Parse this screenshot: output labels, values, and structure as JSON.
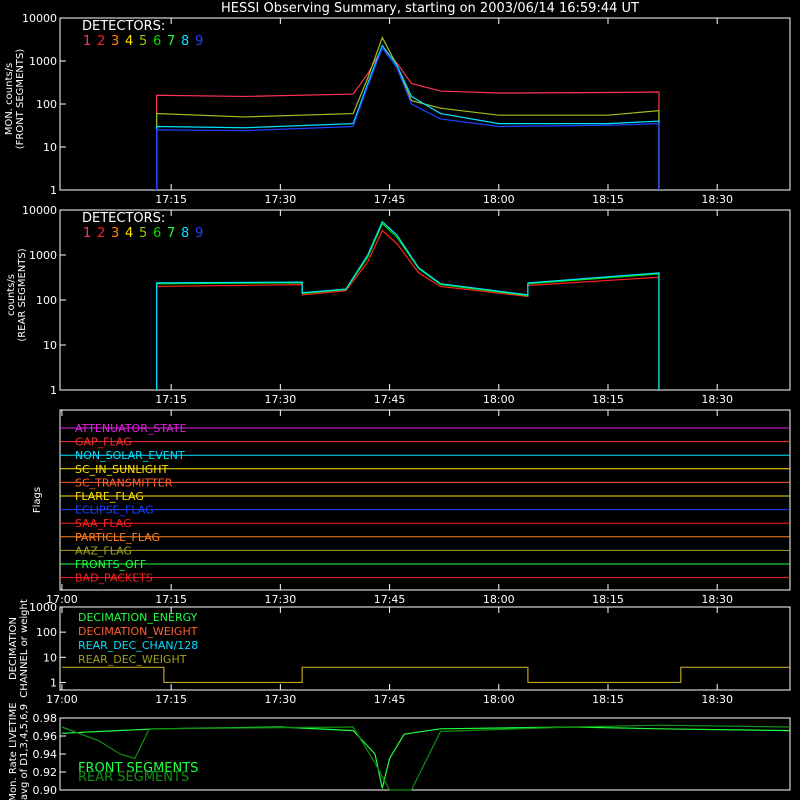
{
  "title": "HESSI Observing Summary, starting on 2003/06/14 16:59:44 UT",
  "time_ticks": [
    "17:15",
    "17:30",
    "17:45",
    "18:00",
    "18:15",
    "18:30"
  ],
  "time_ticks_full": [
    "17:00",
    "17:15",
    "17:30",
    "17:45",
    "18:00",
    "18:15",
    "18:30"
  ],
  "detectors_label": "DETECTORS:",
  "detectors": [
    {
      "n": "1",
      "color": "#ff3355"
    },
    {
      "n": "2",
      "color": "#ff2020"
    },
    {
      "n": "3",
      "color": "#ff8800"
    },
    {
      "n": "4",
      "color": "#ffe000"
    },
    {
      "n": "5",
      "color": "#a0c020"
    },
    {
      "n": "6",
      "color": "#00e000"
    },
    {
      "n": "7",
      "color": "#20ff40"
    },
    {
      "n": "8",
      "color": "#00e0ff"
    },
    {
      "n": "9",
      "color": "#2040ff"
    }
  ],
  "chart_data": [
    {
      "type": "line",
      "ylabel": "MON. counts/s\n(FRONT SEGMENTS)",
      "yscale": "log",
      "ylim": [
        1,
        10000
      ],
      "yticks": [
        "1",
        "10",
        "100",
        "1000",
        "10000"
      ],
      "xlim": [
        "16:59:44",
        "18:40"
      ],
      "series": [
        {
          "name": "1",
          "color": "#ff3355",
          "x": [
            "17:13",
            "17:13",
            "17:25",
            "17:40",
            "17:42",
            "17:44",
            "17:46",
            "17:48",
            "17:52",
            "18:00",
            "18:15",
            "18:22",
            "18:22"
          ],
          "y": [
            1,
            160,
            150,
            170,
            500,
            2000,
            900,
            300,
            200,
            180,
            185,
            190,
            1
          ]
        },
        {
          "name": "5",
          "color": "#a0c020",
          "x": [
            "17:13",
            "17:13",
            "17:25",
            "17:40",
            "17:42",
            "17:44",
            "17:46",
            "17:48",
            "17:52",
            "18:00",
            "18:15",
            "18:22",
            "18:22"
          ],
          "y": [
            1,
            60,
            50,
            60,
            400,
            3500,
            800,
            120,
            80,
            55,
            55,
            70,
            1
          ]
        },
        {
          "name": "8",
          "color": "#00e0ff",
          "x": [
            "17:13",
            "17:13",
            "17:25",
            "17:40",
            "17:42",
            "17:44",
            "17:46",
            "17:48",
            "17:52",
            "18:00",
            "18:15",
            "18:22",
            "18:22"
          ],
          "y": [
            1,
            30,
            28,
            35,
            300,
            2300,
            800,
            150,
            60,
            35,
            35,
            40,
            1
          ]
        },
        {
          "name": "9",
          "color": "#2040ff",
          "x": [
            "17:13",
            "17:13",
            "17:25",
            "17:40",
            "17:42",
            "17:44",
            "17:46",
            "17:48",
            "17:52",
            "18:00",
            "18:15",
            "18:22",
            "18:22"
          ],
          "y": [
            1,
            25,
            24,
            30,
            260,
            2000,
            700,
            100,
            45,
            30,
            32,
            35,
            1
          ]
        }
      ]
    },
    {
      "type": "line",
      "ylabel": "counts/s\n(REAR SEGMENTS)",
      "yscale": "log",
      "ylim": [
        1,
        10000
      ],
      "yticks": [
        "1",
        "10",
        "100",
        "1000",
        "10000"
      ],
      "xlim": [
        "16:59:44",
        "18:40"
      ],
      "series": [
        {
          "name": "2",
          "color": "#ff2020",
          "x": [
            "17:13",
            "17:13",
            "17:33",
            "17:33",
            "17:39",
            "17:42",
            "17:44",
            "17:46",
            "17:49",
            "17:52",
            "18:04",
            "18:04",
            "18:22",
            "18:22"
          ],
          "y": [
            1,
            200,
            220,
            130,
            160,
            700,
            3500,
            1800,
            400,
            200,
            120,
            210,
            320,
            1
          ]
        },
        {
          "name": "6",
          "color": "#00e000",
          "x": [
            "17:13",
            "17:13",
            "17:33",
            "17:33",
            "17:39",
            "17:42",
            "17:44",
            "17:46",
            "17:49",
            "17:52",
            "18:04",
            "18:04",
            "18:22",
            "18:22"
          ],
          "y": [
            1,
            230,
            240,
            140,
            170,
            900,
            5000,
            2500,
            500,
            220,
            125,
            230,
            380,
            1
          ]
        },
        {
          "name": "8",
          "color": "#00e0ff",
          "x": [
            "17:13",
            "17:13",
            "17:33",
            "17:33",
            "17:39",
            "17:42",
            "17:44",
            "17:46",
            "17:49",
            "17:52",
            "18:04",
            "18:04",
            "18:22",
            "18:22"
          ],
          "y": [
            1,
            240,
            250,
            145,
            175,
            1000,
            5500,
            2800,
            520,
            230,
            130,
            240,
            400,
            1
          ]
        }
      ]
    },
    {
      "type": "line",
      "ylabel": "Flags",
      "flags": [
        {
          "name": "ATTENUATOR_STATE",
          "color": "#e020e0"
        },
        {
          "name": "GAP_FLAG",
          "color": "#ff3030"
        },
        {
          "name": "NON_SOLAR_EVENT",
          "color": "#00e0ff"
        },
        {
          "name": "SC_IN_SUNLIGHT",
          "color": "#ffe000"
        },
        {
          "name": "SC_TRANSMITTER",
          "color": "#ff6030"
        },
        {
          "name": "FLARE_FLAG",
          "color": "#ffe000"
        },
        {
          "name": "ECLIPSE_FLAG",
          "color": "#2040ff"
        },
        {
          "name": "SAA_FLAG",
          "color": "#ff2020"
        },
        {
          "name": "PARTICLE_FLAG",
          "color": "#ff8020"
        },
        {
          "name": "AAZ_FLAG",
          "color": "#a0a020"
        },
        {
          "name": "FRONTS_OFF",
          "color": "#20ff40"
        },
        {
          "name": "BAD_PACKETS",
          "color": "#ff2020"
        }
      ]
    },
    {
      "type": "line",
      "ylabel": "DECIMATION\nCHANNEL or weight",
      "yscale": "log",
      "ylim": [
        0.5,
        1000
      ],
      "yticks": [
        "1",
        "10",
        "100",
        "1000"
      ],
      "legend": [
        {
          "name": "DECIMATION_ENERGY",
          "color": "#20ff40"
        },
        {
          "name": "DECIMATION_WEIGHT",
          "color": "#ff6030"
        },
        {
          "name": "REAR_DEC_CHAN/128",
          "color": "#00e0ff"
        },
        {
          "name": "REAR_DEC_WEIGHT",
          "color": "#a0a020"
        }
      ],
      "series": [
        {
          "name": "REAR_DEC_WEIGHT",
          "color": "#c0a020",
          "x": [
            "17:00",
            "17:14",
            "17:14",
            "17:33",
            "17:33",
            "18:04",
            "18:04",
            "18:25",
            "18:25",
            "18:40"
          ],
          "y": [
            4,
            4,
            1,
            1,
            4,
            4,
            1,
            1,
            4,
            4
          ]
        }
      ]
    },
    {
      "type": "line",
      "ylabel": "Mon. Rate LIVETIME\navg of D1,3,4,5,6,9",
      "ylim": [
        0.9,
        0.98
      ],
      "yticks": [
        "0.90",
        "0.92",
        "0.94",
        "0.96",
        "0.98"
      ],
      "legend": [
        {
          "name": "FRONT SEGMENTS",
          "color": "#20ff40"
        },
        {
          "name": "REAR SEGMENTS",
          "color": "#109010"
        }
      ],
      "series": [
        {
          "name": "FRONT SEGMENTS",
          "color": "#20ff40",
          "x": [
            "17:00",
            "17:13",
            "17:30",
            "17:40",
            "17:43",
            "17:44",
            "17:45",
            "17:47",
            "17:52",
            "18:10",
            "18:22",
            "18:40"
          ],
          "y": [
            0.963,
            0.968,
            0.97,
            0.966,
            0.94,
            0.902,
            0.935,
            0.962,
            0.968,
            0.97,
            0.968,
            0.966
          ]
        },
        {
          "name": "REAR SEGMENTS",
          "color": "#109010",
          "x": [
            "17:00",
            "17:05",
            "17:08",
            "17:10",
            "17:12",
            "17:40",
            "17:43",
            "17:45",
            "17:48",
            "17:52",
            "18:10",
            "18:22",
            "18:40"
          ],
          "y": [
            0.97,
            0.955,
            0.94,
            0.935,
            0.968,
            0.97,
            0.93,
            0.9,
            0.9,
            0.965,
            0.97,
            0.972,
            0.97
          ]
        }
      ]
    }
  ]
}
